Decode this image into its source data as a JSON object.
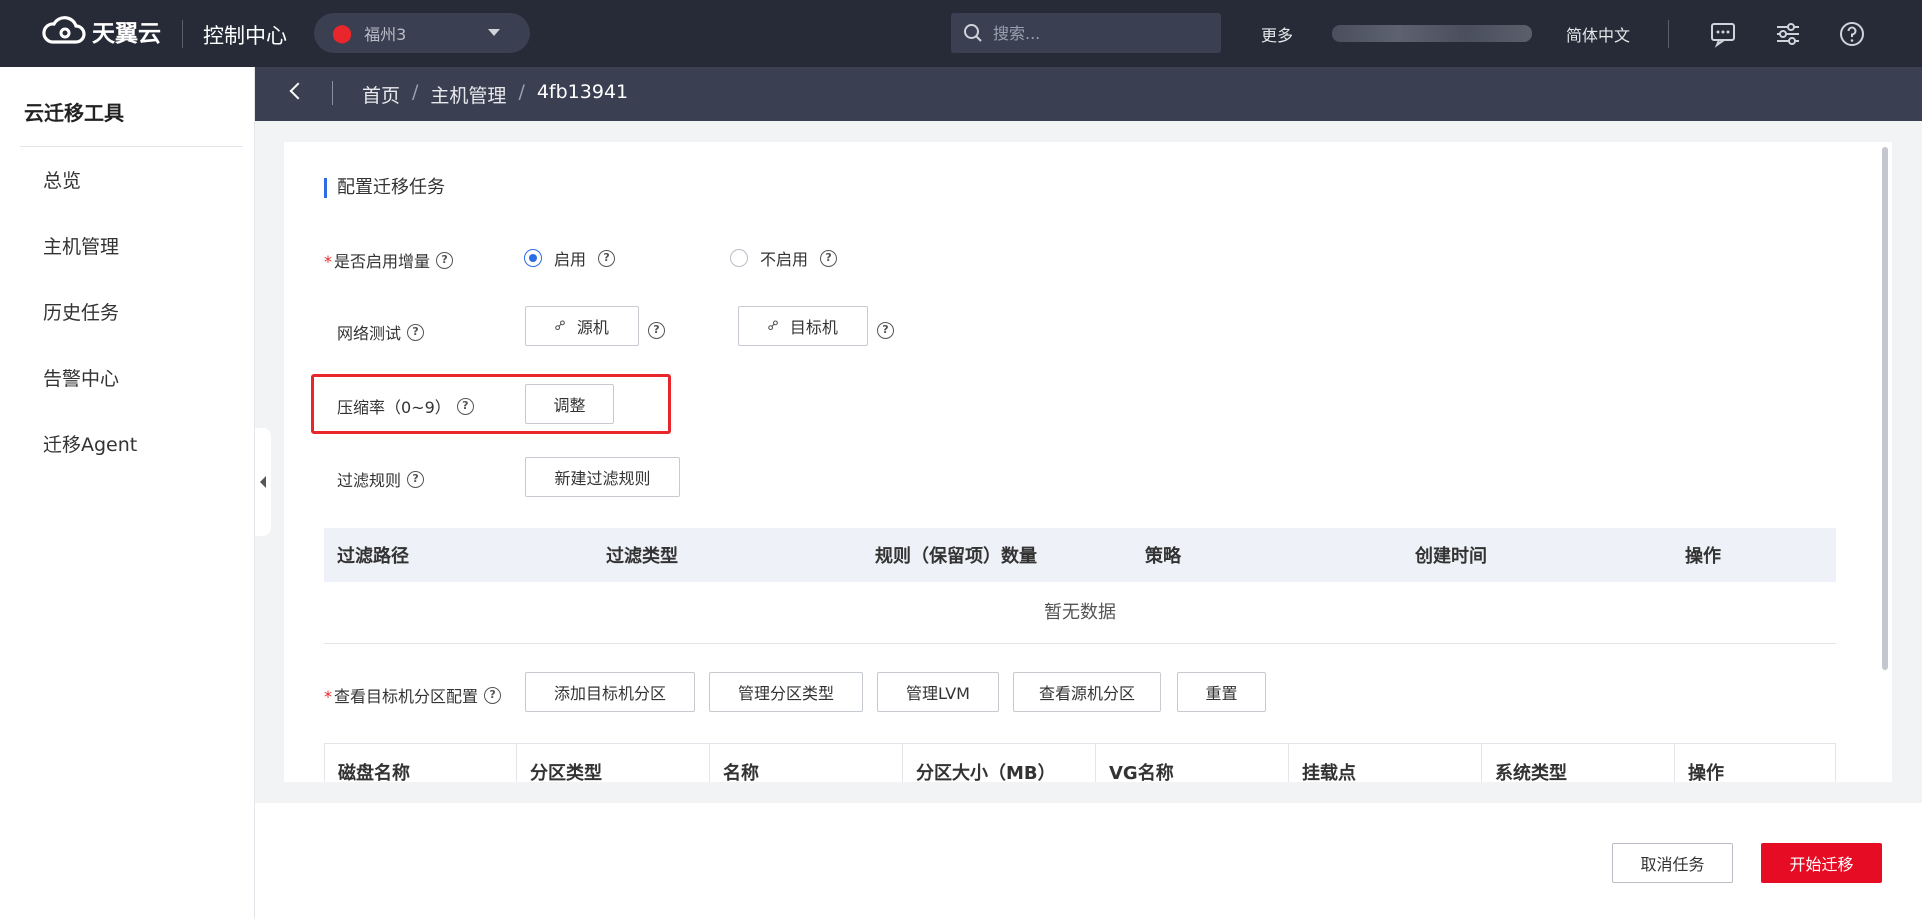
{
  "topbar": {
    "brand": "天翼云",
    "console": "控制中心",
    "region": "福州3",
    "search_placeholder": "搜索...",
    "more": "更多",
    "lang": "简体中文"
  },
  "sidebar": {
    "title": "云迁移工具",
    "items": [
      {
        "label": "总览"
      },
      {
        "label": "主机管理"
      },
      {
        "label": "历史任务"
      },
      {
        "label": "告警中心"
      },
      {
        "label": "迁移Agent"
      }
    ]
  },
  "breadcrumb": [
    "首页",
    "主机管理",
    "4fb13941"
  ],
  "form": {
    "section_title": "配置迁移任务",
    "incremental": {
      "label": "是否启用增量",
      "enable": "启用",
      "disable": "不启用",
      "selected": "启用"
    },
    "network_test": {
      "label": "网络测试",
      "source": "源机",
      "target": "目标机"
    },
    "compression": {
      "label": "压缩率（0~9）",
      "button": "调整"
    },
    "filter": {
      "label": "过滤规则",
      "button": "新建过滤规则"
    },
    "filter_table": {
      "columns": [
        "过滤路径",
        "过滤类型",
        "规则（保留项）数量",
        "策略",
        "创建时间",
        "操作"
      ],
      "empty_text": "暂无数据"
    },
    "partition": {
      "label": "查看目标机分区配置",
      "buttons": [
        "添加目标机分区",
        "管理分区类型",
        "管理LVM",
        "查看源机分区",
        "重置"
      ]
    },
    "partition_table": {
      "columns": [
        "磁盘名称",
        "分区类型",
        "名称",
        "分区大小（MB）",
        "VG名称",
        "挂载点",
        "系统类型",
        "操作"
      ]
    }
  },
  "footer": {
    "cancel": "取消任务",
    "start": "开始迁移"
  },
  "colors": {
    "topbar_bg": "#272b38",
    "breadcrumb_bg": "#3a4052",
    "primary": "#2e6ce4",
    "danger": "#e60c24"
  }
}
